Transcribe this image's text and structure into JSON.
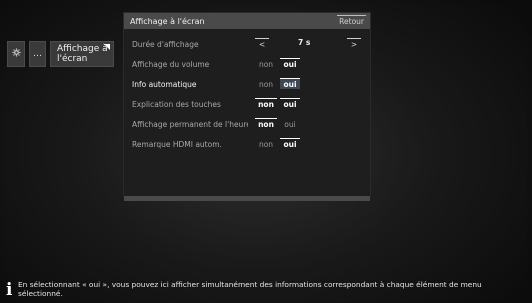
{
  "breadcrumb": {
    "settings_icon": "gear-icon",
    "ellipsis": "…",
    "current": "Affichage à l'écran"
  },
  "panel": {
    "title": "Affichage à l'écran",
    "back_label": "Retour",
    "rows": [
      {
        "label": "Durée d'affichage",
        "type": "stepper",
        "left": "<",
        "value": "7 s",
        "right": ">"
      },
      {
        "label": "Affichage du volume",
        "non": "non",
        "oui": "oui",
        "selected": "oui"
      },
      {
        "label": "Info automatique",
        "non": "non",
        "oui": "oui",
        "selected": "oui",
        "active": true
      },
      {
        "label": "Explication des touches",
        "non": "non",
        "oui": "oui",
        "selected": "both"
      },
      {
        "label": "Affichage permanent de l'heure",
        "non": "non",
        "oui": "oui",
        "selected": "non"
      },
      {
        "label": "Remarque HDMI autom.",
        "non": "non",
        "oui": "oui",
        "selected": "oui"
      }
    ]
  },
  "info": {
    "icon": "info-icon",
    "text": "En sélectionnant « oui », vous pouvez ici afficher simultanément des informations correspondant à chaque élément de menu sélectionné."
  }
}
